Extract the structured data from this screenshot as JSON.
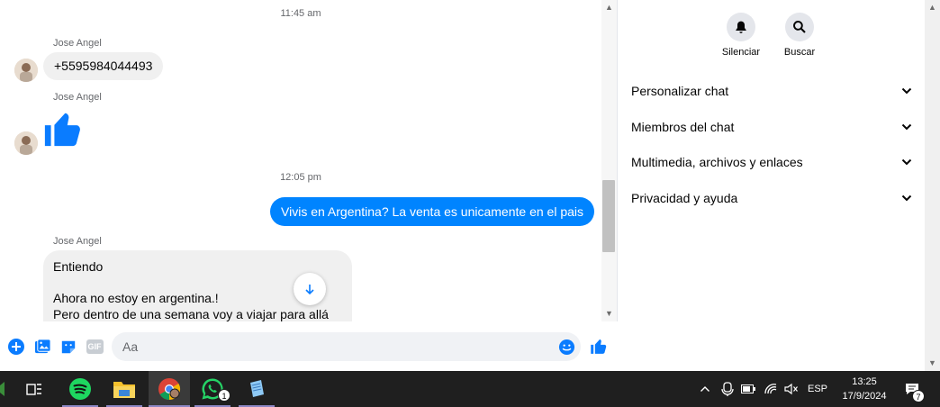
{
  "chat": {
    "time1": "11:45 am",
    "time2": "12:05 pm",
    "sender": "Jose Angel",
    "msg_phone": "+5595984044493",
    "msg_out": "Vivis en Argentina? La venta es unicamente en el pais",
    "msg_long": {
      "line1": "Entiendo",
      "line2": "Ahora no estoy en argentina.!",
      "line3": "Pero dentro de una semana voy a viajar para allá"
    }
  },
  "composer": {
    "placeholder": "Aa",
    "gif_label": "GIF",
    "accent": "#0084ff"
  },
  "panel": {
    "actions": [
      {
        "label": "Silenciar",
        "icon": "bell-icon"
      },
      {
        "label": "Buscar",
        "icon": "search-icon"
      }
    ],
    "sections": [
      {
        "label": "Personalizar chat"
      },
      {
        "label": "Miembros del chat"
      },
      {
        "label": "Multimedia, archivos y enlaces"
      },
      {
        "label": "Privacidad y ayuda"
      }
    ]
  },
  "taskbar": {
    "lang": "ESP",
    "time": "13:25",
    "date": "17/9/2024",
    "whatsapp_badge": "1",
    "notification_badge": "7",
    "apps": [
      "start-icon",
      "task-view-icon",
      "spotify-icon",
      "file-explorer-icon",
      "chrome-icon",
      "whatsapp-icon",
      "notepad-icon"
    ]
  }
}
